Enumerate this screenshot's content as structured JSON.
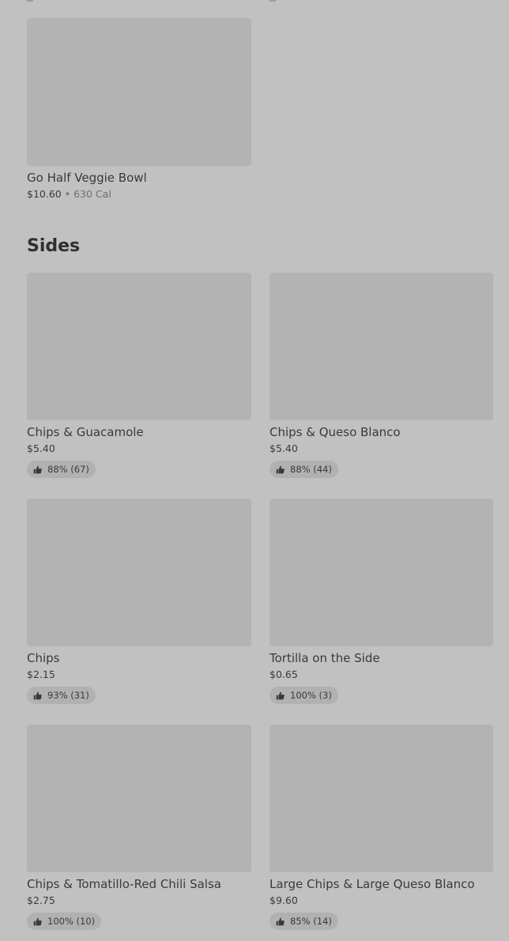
{
  "top_item": {
    "name": "Go Half Veggie Bowl",
    "price": "$10.60",
    "separator": "•",
    "calories": "630 Cal"
  },
  "section": {
    "title": "Sides",
    "items": [
      {
        "name": "Chips & Guacamole",
        "price": "$5.40",
        "rating": "88% (67)"
      },
      {
        "name": "Chips & Queso Blanco",
        "price": "$5.40",
        "rating": "88% (44)"
      },
      {
        "name": "Chips",
        "price": "$2.15",
        "rating": "93% (31)"
      },
      {
        "name": "Tortilla on the Side",
        "price": "$0.65",
        "rating": "100% (3)"
      },
      {
        "name": "Chips & Tomatillo-Red Chili Salsa",
        "price": "$2.75",
        "rating": "100% (10)"
      },
      {
        "name": "Large Chips & Large Queso Blanco",
        "price": "$9.60",
        "rating": "85% (14)"
      }
    ]
  },
  "icons": {
    "rating": "thumbs-up-icon"
  }
}
